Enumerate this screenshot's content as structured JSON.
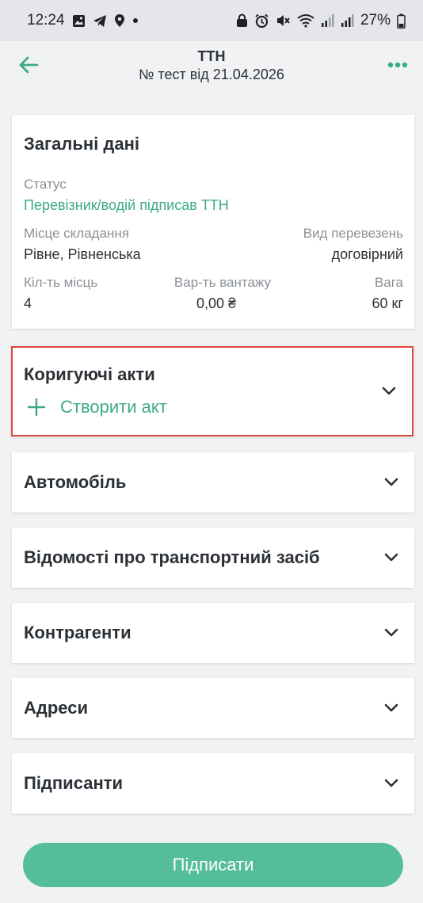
{
  "status_bar": {
    "time": "12:24",
    "battery": "27%"
  },
  "header": {
    "title": "ТТН",
    "subtitle": "№ тест від 21.04.2026"
  },
  "general": {
    "title": "Загальні дані",
    "status_label": "Статус",
    "status_value": "Перевізник/водій підписав ТТН",
    "place_label": "Місце складання",
    "place_value": "Рівне, Рівненська",
    "transport_label": "Вид перевезень",
    "transport_value": "договірний",
    "count_label": "Кіл-ть місць",
    "count_value": "4",
    "cost_label": "Вар-ть вантажу",
    "cost_value": "0,00 ₴",
    "weight_label": "Вага",
    "weight_value": "60 кг"
  },
  "acts": {
    "title": "Коригуючі акти",
    "create_label": "Створити акт"
  },
  "sections": [
    "Автомобіль",
    "Відомості про транспортний засіб",
    "Контрагенти",
    "Адреси",
    "Підписанти"
  ],
  "sign_button": "Підписати",
  "colors": {
    "accent": "#3daa85",
    "button": "#53be97",
    "highlight_border": "#e0463c"
  }
}
